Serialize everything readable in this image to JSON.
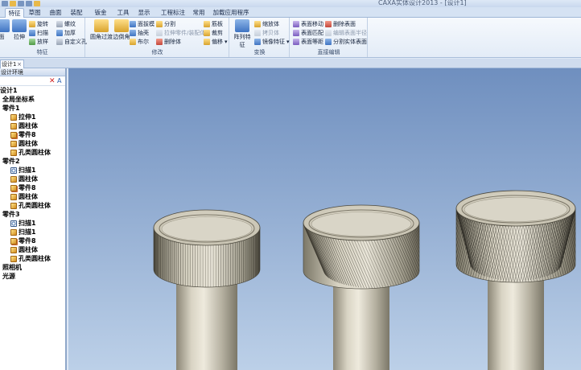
{
  "app": {
    "window_title": "CAXA实体设计2013 - [设计1]",
    "quick_access_icons": [
      "new-icon",
      "open-icon",
      "save-icon",
      "undo-icon",
      "help-icon"
    ]
  },
  "menu_tabs": [
    {
      "label": "特征",
      "active": true
    },
    {
      "label": "草图",
      "active": false
    },
    {
      "label": "曲面",
      "active": false
    },
    {
      "label": "装配",
      "active": false
    },
    {
      "label": "钣金",
      "active": false
    },
    {
      "label": "工具",
      "active": false
    },
    {
      "label": "显示",
      "active": false
    },
    {
      "label": "工程标注",
      "active": false
    },
    {
      "label": "常用",
      "active": false
    },
    {
      "label": "加载应用程序",
      "active": false
    }
  ],
  "ribbon": {
    "groups": {
      "feature": {
        "label": "特征",
        "partial_big": "面",
        "stretch": "拉伸",
        "items": [
          "旋转",
          "扫描",
          "放样",
          "螺纹",
          "加厚",
          "自定义孔"
        ]
      },
      "modify": {
        "label": "修改",
        "fillet": "圆角过渡",
        "chamfer": "边倒角",
        "items": [
          "面拔模",
          "抽壳",
          "布尔",
          "分割",
          "拉伸零件/装配体",
          "删除体",
          "筋板",
          "裁剪",
          "偏移"
        ]
      },
      "transform": {
        "label": "变换",
        "array": "阵列特征",
        "items": [
          "缩放体",
          "拷贝体",
          "镜像特征"
        ]
      },
      "direct_edit": {
        "label": "直接编辑",
        "items": [
          "表面移动",
          "表面匹配",
          "表面等距",
          "删除表面",
          "编辑表面半径",
          "分割实体表面"
        ]
      }
    }
  },
  "document_tab": {
    "label": "设计1",
    "close": "×"
  },
  "panel": {
    "title": "设计环境",
    "tools": {
      "delete": "✕",
      "properties": "A"
    },
    "tree": [
      {
        "label": "设计1",
        "level": 0,
        "icon": "none"
      },
      {
        "label": "全局坐标系",
        "level": 1,
        "icon": "none"
      },
      {
        "label": "零件1",
        "level": 1,
        "icon": "none"
      },
      {
        "label": "拉伸1",
        "level": 2,
        "icon": "feature-icon"
      },
      {
        "label": "圆柱体",
        "level": 2,
        "icon": "feature-icon"
      },
      {
        "label": "零件8",
        "level": 2,
        "icon": "part-icon"
      },
      {
        "label": "圆柱体",
        "level": 2,
        "icon": "feature-icon"
      },
      {
        "label": "孔类圆柱体",
        "level": 2,
        "icon": "feature-icon"
      },
      {
        "label": "零件2",
        "level": 1,
        "icon": "none"
      },
      {
        "label": "扫描1",
        "level": 2,
        "icon": "sweep-icon"
      },
      {
        "label": "圆柱体",
        "level": 2,
        "icon": "feature-icon"
      },
      {
        "label": "零件8",
        "level": 2,
        "icon": "part-icon"
      },
      {
        "label": "圆柱体",
        "level": 2,
        "icon": "feature-icon"
      },
      {
        "label": "孔类圆柱体",
        "level": 2,
        "icon": "feature-icon"
      },
      {
        "label": "零件3",
        "level": 1,
        "icon": "none"
      },
      {
        "label": "扫描1",
        "level": 2,
        "icon": "sweep-icon"
      },
      {
        "label": "扫描1",
        "level": 2,
        "icon": "feature-icon"
      },
      {
        "label": "零件8",
        "level": 2,
        "icon": "part-icon"
      },
      {
        "label": "圆柱体",
        "level": 2,
        "icon": "feature-icon"
      },
      {
        "label": "孔类圆柱体",
        "level": 2,
        "icon": "feature-icon"
      },
      {
        "label": "照相机",
        "level": 1,
        "icon": "none"
      },
      {
        "label": "光源",
        "level": 1,
        "icon": "none"
      }
    ]
  },
  "viewport": {
    "background_top": "#6f8fbf",
    "background_bottom": "#bcd0e8",
    "models": [
      {
        "name": "straight-knurled-knob",
        "knurl": "straight"
      },
      {
        "name": "diagonal-knurled-knob",
        "knurl": "diagonal"
      },
      {
        "name": "diamond-knurled-knob",
        "knurl": "diamond"
      }
    ]
  },
  "colors": {
    "accent": "#2b579a",
    "metal_light": "#e6e2d4",
    "metal_dark": "#6e6a5c"
  }
}
